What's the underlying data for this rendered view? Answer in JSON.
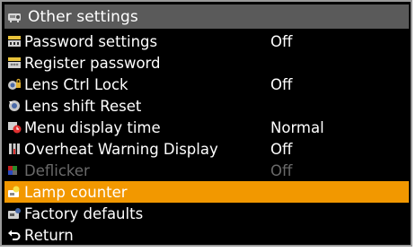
{
  "menu": {
    "title": "Other settings",
    "items": [
      {
        "label": "Password settings",
        "value": "Off"
      },
      {
        "label": "Register password",
        "value": ""
      },
      {
        "label": "Lens Ctrl Lock",
        "value": "Off"
      },
      {
        "label": "Lens shift Reset",
        "value": ""
      },
      {
        "label": "Menu display time",
        "value": "Normal"
      },
      {
        "label": "Overheat Warning Display",
        "value": "Off"
      },
      {
        "label": "Deflicker",
        "value": "Off"
      },
      {
        "label": "Lamp counter",
        "value": ""
      },
      {
        "label": "Factory defaults",
        "value": ""
      },
      {
        "label": "Return",
        "value": ""
      }
    ],
    "selected_item": "Lamp counter",
    "disabled_item": "Deflicker"
  },
  "colors": {
    "background": "#000000",
    "header": "#5a5a5a",
    "highlight": "#f29800",
    "text": "#ffffff",
    "disabled_text": "#6a6a6a",
    "border": "#9a9a9a"
  }
}
